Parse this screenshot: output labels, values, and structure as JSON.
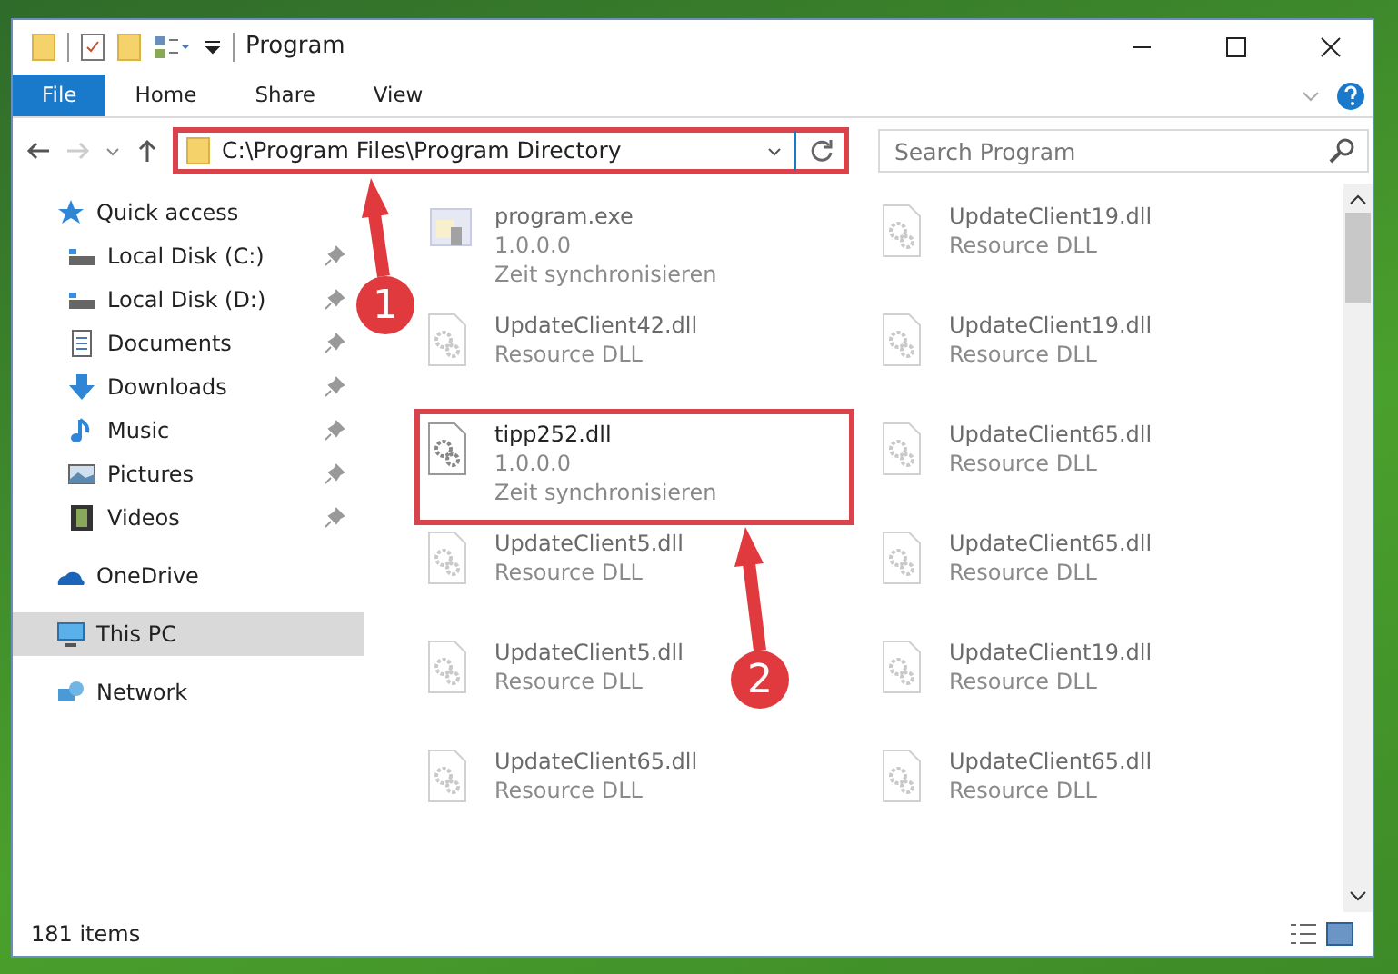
{
  "window": {
    "title": "Program"
  },
  "ribbon_tabs": [
    {
      "label": "File",
      "selected": true
    },
    {
      "label": "Home",
      "selected": false
    },
    {
      "label": "Share",
      "selected": false
    },
    {
      "label": "View",
      "selected": false
    }
  ],
  "address_bar": {
    "path": "C:\\Program Files\\Program Directory",
    "highlighted": true
  },
  "search": {
    "placeholder": "Search Program"
  },
  "sidebar": {
    "items": [
      {
        "label": "Quick access",
        "kind": "star",
        "selected": false,
        "children": [
          {
            "label": "Local Disk (C:)",
            "kind": "drive",
            "pinned": true,
            "selected": false
          },
          {
            "label": "Local Disk (D:)",
            "kind": "drive",
            "pinned": true,
            "selected": false
          },
          {
            "label": "Documents",
            "kind": "document",
            "pinned": true,
            "selected": false
          },
          {
            "label": "Downloads",
            "kind": "download",
            "pinned": true,
            "selected": false
          },
          {
            "label": "Music",
            "kind": "music",
            "pinned": true,
            "selected": false
          },
          {
            "label": "Pictures",
            "kind": "picture",
            "pinned": true,
            "selected": false
          },
          {
            "label": "Videos",
            "kind": "video",
            "pinned": true,
            "selected": false
          }
        ]
      },
      {
        "label": "OneDrive",
        "kind": "cloud",
        "selected": false
      },
      {
        "label": "This PC",
        "kind": "computer",
        "selected": true
      },
      {
        "label": "Network",
        "kind": "network",
        "selected": false
      }
    ]
  },
  "files": [
    {
      "name": "program.exe",
      "lines": [
        "1.0.0.0",
        "Zeit synchronisieren"
      ],
      "kind": "exe",
      "highlighted": false
    },
    {
      "name": "UpdateClient19.dll",
      "lines": [
        "Resource DLL"
      ],
      "kind": "dll",
      "highlighted": false
    },
    {
      "name": "UpdateClient42.dll",
      "lines": [
        "Resource DLL"
      ],
      "kind": "dll",
      "highlighted": false
    },
    {
      "name": "UpdateClient19.dll",
      "lines": [
        "Resource DLL"
      ],
      "kind": "dll",
      "highlighted": false
    },
    {
      "name": "tipp252.dll",
      "lines": [
        "1.0.0.0",
        "Zeit synchronisieren"
      ],
      "kind": "dll",
      "highlighted": true
    },
    {
      "name": "UpdateClient65.dll",
      "lines": [
        "Resource DLL"
      ],
      "kind": "dll",
      "highlighted": false
    },
    {
      "name": "UpdateClient5.dll",
      "lines": [
        "Resource DLL"
      ],
      "kind": "dll",
      "highlighted": false
    },
    {
      "name": "UpdateClient65.dll",
      "lines": [
        "Resource DLL"
      ],
      "kind": "dll",
      "highlighted": false
    },
    {
      "name": "UpdateClient5.dll",
      "lines": [
        "Resource DLL"
      ],
      "kind": "dll",
      "highlighted": false
    },
    {
      "name": "UpdateClient19.dll",
      "lines": [
        "Resource DLL"
      ],
      "kind": "dll",
      "highlighted": false
    },
    {
      "name": "UpdateClient65.dll",
      "lines": [
        "Resource DLL"
      ],
      "kind": "dll",
      "highlighted": false
    },
    {
      "name": "UpdateClient65.dll",
      "lines": [
        "Resource DLL"
      ],
      "kind": "dll",
      "highlighted": false
    }
  ],
  "annotations": [
    {
      "number": "1"
    },
    {
      "number": "2"
    }
  ],
  "status_bar": {
    "count": "181 items"
  }
}
